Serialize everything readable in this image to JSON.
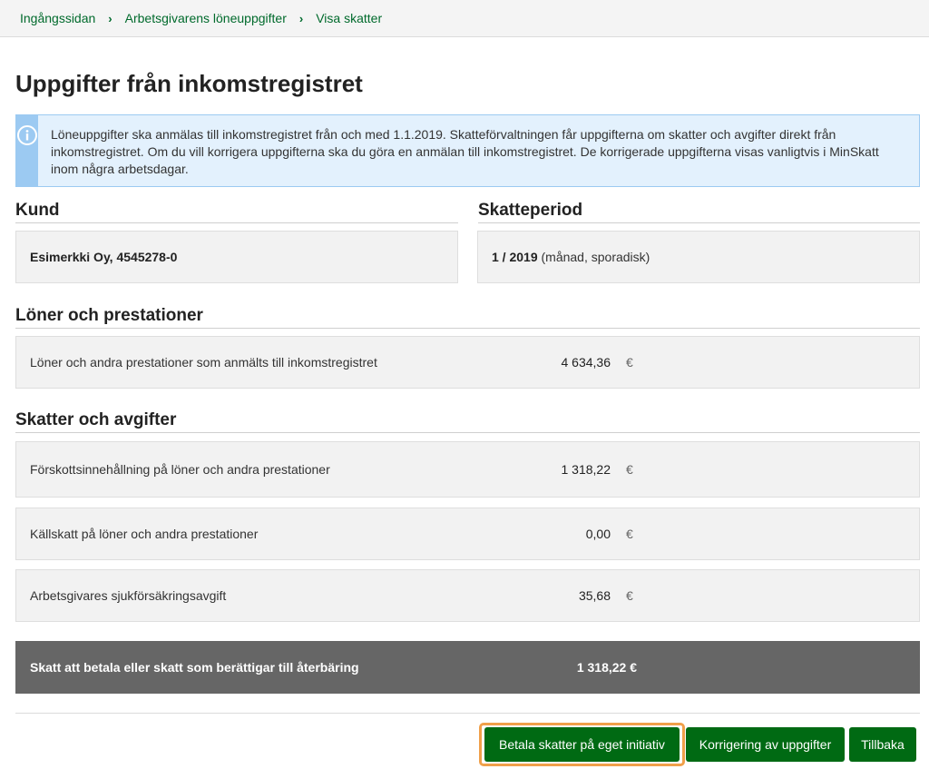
{
  "breadcrumb": {
    "items": [
      "Ingångssidan",
      "Arbetsgivarens löneuppgifter",
      "Visa skatter"
    ],
    "separator": "›"
  },
  "page": {
    "title": "Uppgifter från inkomstregistret"
  },
  "info": {
    "text": "Löneuppgifter ska anmälas till inkomstregistret från och med 1.1.2019. Skatteförvaltningen får uppgifterna om skatter och avgifter direkt från inkomstregistret. Om du vill korrigera uppgifterna ska du göra en anmälan till inkomstregistret. De korrigerade uppgifterna visas vanligtvis i MinSkatt inom några arbetsdagar.",
    "icon": "info-icon"
  },
  "customer": {
    "heading": "Kund",
    "value": "Esimerkki Oy, 4545278-0"
  },
  "period": {
    "heading": "Skatteperiod",
    "value_bold": "1 / 2019",
    "value_rest": " (månad, sporadisk)"
  },
  "wages": {
    "heading": "Löner och prestationer",
    "rows": [
      {
        "label": "Löner och andra prestationer som anmälts till inkomstregistret",
        "value": "4 634,36",
        "currency": "€"
      }
    ]
  },
  "taxes": {
    "heading": "Skatter och avgifter",
    "rows": [
      {
        "label": "Förskottsinnehållning på löner och andra prestationer",
        "value": "1 318,22",
        "currency": "€"
      },
      {
        "label": "Källskatt på löner och andra prestationer",
        "value": "0,00",
        "currency": "€"
      },
      {
        "label": "Arbetsgivares sjukförsäkringsavgift",
        "value": "35,68",
        "currency": "€"
      }
    ]
  },
  "total": {
    "label": "Skatt att betala eller skatt som berättigar till återbäring",
    "value": "1 318,22 €"
  },
  "buttons": {
    "pay": "Betala skatter på eget initiativ",
    "correct": "Korrigering av uppgifter",
    "back": "Tillbaka"
  },
  "colors": {
    "primary_green": "#006a13",
    "link_green": "#006a2c",
    "info_bg": "#e3f1fd",
    "info_stripe": "#9ccaf2",
    "total_bg": "#666666",
    "focus": "#f0a04a"
  }
}
